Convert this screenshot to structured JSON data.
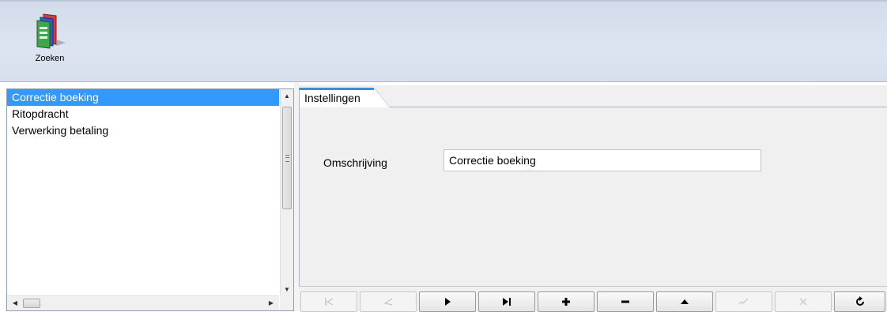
{
  "ribbon": {
    "search_button_label": "Zoeken",
    "search_icon": "books-icon"
  },
  "list": {
    "items": [
      {
        "label": "Correctie boeking",
        "selected": true
      },
      {
        "label": "Ritopdracht",
        "selected": false
      },
      {
        "label": "Verwerking betaling",
        "selected": false
      }
    ]
  },
  "detail": {
    "tabs": [
      {
        "label": "Instellingen",
        "active": true
      }
    ],
    "fields": {
      "omschrijving_label": "Omschrijving",
      "omschrijving_value": "Correctie boeking"
    }
  },
  "navigator": {
    "buttons": [
      {
        "icon": "first-icon",
        "enabled": false
      },
      {
        "icon": "prior-icon",
        "enabled": false
      },
      {
        "icon": "next-icon",
        "enabled": true
      },
      {
        "icon": "last-icon",
        "enabled": true
      },
      {
        "icon": "insert-icon",
        "enabled": true
      },
      {
        "icon": "delete-icon",
        "enabled": true
      },
      {
        "icon": "edit-icon",
        "enabled": true
      },
      {
        "icon": "post-icon",
        "enabled": false
      },
      {
        "icon": "cancel-icon",
        "enabled": false
      },
      {
        "icon": "refresh-icon",
        "enabled": true
      }
    ]
  },
  "colors": {
    "selection": "#3399ff",
    "tab_accent": "#3f8cd8",
    "ribbon_bg": "#dde4f1"
  }
}
